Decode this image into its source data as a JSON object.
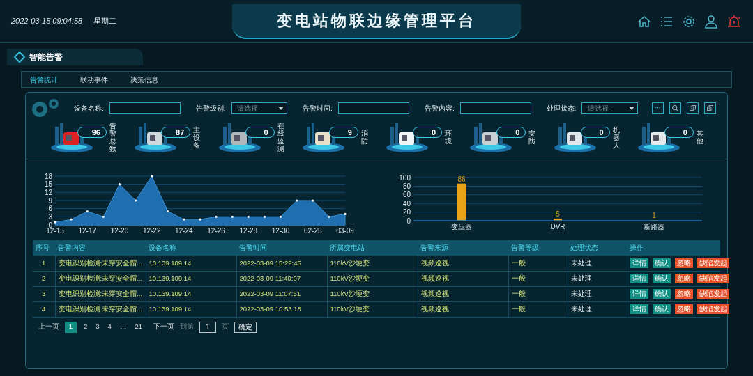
{
  "header": {
    "date": "2022-03-15",
    "time": "09:04:58",
    "weekday": "星期二",
    "title": "变电站物联边缘管理平台"
  },
  "section_title": "智能告警",
  "tabs": [
    {
      "label": "告警统计",
      "selected": true
    },
    {
      "label": "联动事件",
      "selected": false
    },
    {
      "label": "决策信息",
      "selected": false
    }
  ],
  "filters": [
    {
      "kind": "input",
      "label": "设备名称:"
    },
    {
      "kind": "select",
      "label": "告警级别:",
      "placeholder": "-请选择-"
    },
    {
      "kind": "input",
      "label": "告警时间:"
    },
    {
      "kind": "input",
      "label": "告警内容:"
    },
    {
      "kind": "select",
      "label": "处理状态:",
      "placeholder": "-请选择-"
    }
  ],
  "filter_buttons": [
    {
      "label": "···"
    }
  ],
  "stats": [
    {
      "count": "96",
      "label": "告警总数"
    },
    {
      "count": "87",
      "label": "主设备"
    },
    {
      "count": "0",
      "label": "在线监测"
    },
    {
      "count": "9",
      "label": "消防"
    },
    {
      "count": "0",
      "label": "环境"
    },
    {
      "count": "0",
      "label": "安防"
    },
    {
      "count": "0",
      "label": "机器人"
    },
    {
      "count": "0",
      "label": "其他"
    }
  ],
  "trend_chart": {
    "chart_data": {
      "type": "area",
      "categories": [
        "12-15",
        null,
        "12-17",
        null,
        "12-20",
        null,
        "12-22",
        null,
        "12-24",
        null,
        "12-26",
        null,
        "12-28",
        null,
        "12-30",
        null,
        "02-25",
        null,
        "03-09"
      ],
      "series": [
        {
          "color": "#1f6fb0",
          "values": [
            1,
            2,
            5,
            3,
            15,
            9,
            18,
            5,
            2,
            2,
            3,
            3,
            3,
            3,
            3,
            9,
            9,
            3,
            4
          ]
        }
      ],
      "ylim": [
        0,
        18
      ],
      "yticks": [
        0,
        3,
        6,
        9,
        12,
        15,
        18
      ],
      "grid": true
    }
  },
  "device_chart": {
    "chart_data": {
      "type": "bar",
      "categories": [
        "变压器",
        "DVR",
        "断路器"
      ],
      "series": [
        {
          "color": "#e8a317",
          "values": [
            86,
            5,
            1
          ]
        }
      ],
      "ylim": [
        0,
        100
      ],
      "yticks": [
        0,
        20,
        40,
        60,
        80,
        100
      ],
      "grid": true,
      "data_labels": true
    }
  },
  "table": {
    "columns": [
      "序号",
      "告警内容",
      "设备名称",
      "告警时间",
      "所属变电站",
      "告警来源",
      "告警等级",
      "处理状态",
      "操作"
    ],
    "rows": [
      {
        "cells": [
          "1",
          "变电识别检测:未穿安全帽...",
          "10.139.109.14",
          "2022-03-09 15:22:45",
          "110kV沙埂变",
          "视频巡视",
          "一般",
          "未处理"
        ],
        "actions": [
          "详情",
          "确认",
          "忽略",
          "缺陷发起"
        ]
      },
      {
        "cells": [
          "2",
          "变电识别检测:未穿安全帽...",
          "10.139.109.14",
          "2022-03-09 11:40:07",
          "110kV沙埂变",
          "视频巡视",
          "一般",
          "未处理"
        ],
        "actions": [
          "详情",
          "确认",
          "忽略",
          "缺陷发起"
        ]
      },
      {
        "cells": [
          "3",
          "变电识别检测:未穿安全帽...",
          "10.139.109.14",
          "2022-03-09 11:07:51",
          "110kV沙埂变",
          "视频巡视",
          "一般",
          "未处理"
        ],
        "actions": [
          "详情",
          "确认",
          "忽略",
          "缺陷发起"
        ]
      },
      {
        "cells": [
          "4",
          "变电识别检测:未穿安全帽...",
          "10.139.109.14",
          "2022-03-09 10:53:18",
          "110kV沙埂变",
          "视频巡视",
          "一般",
          "未处理"
        ],
        "actions": [
          "详情",
          "确认",
          "忽略",
          "缺陷发起"
        ]
      }
    ]
  },
  "pagination": {
    "prev": "上一页",
    "pages": [
      {
        "label": "1",
        "selected": true
      },
      {
        "label": "2",
        "selected": false
      },
      {
        "label": "3",
        "selected": false
      },
      {
        "label": "4",
        "selected": false
      },
      {
        "label": "…",
        "selected": false
      },
      {
        "label": "21",
        "selected": false
      }
    ],
    "next": "下一页",
    "goto_label": "到第",
    "goto_value": "1",
    "page_unit": "页",
    "confirm": "确定"
  }
}
